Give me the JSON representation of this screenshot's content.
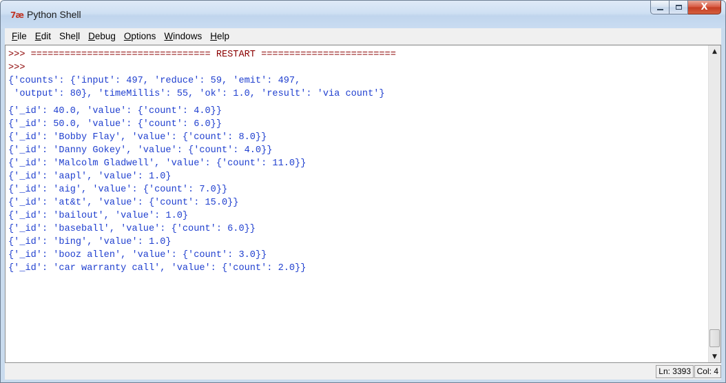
{
  "window": {
    "title": "Python Shell",
    "app_icon_text": "7æ",
    "close_glyph": "X"
  },
  "menu": [
    {
      "pre": "",
      "ul": "F",
      "post": "ile"
    },
    {
      "pre": "",
      "ul": "E",
      "post": "dit"
    },
    {
      "pre": "She",
      "ul": "l",
      "post": "l"
    },
    {
      "pre": "",
      "ul": "D",
      "post": "ebug"
    },
    {
      "pre": "",
      "ul": "O",
      "post": "ptions"
    },
    {
      "pre": "",
      "ul": "W",
      "post": "indows"
    },
    {
      "pre": "",
      "ul": "H",
      "post": "elp"
    }
  ],
  "shell": {
    "lines": [
      {
        "text": ">>> ================================ RESTART ========================",
        "kind": "prompt"
      },
      {
        "text": ">>> ",
        "kind": "prompt"
      },
      {
        "text": "{'counts': {'input': 497, 'reduce': 59, 'emit': 497,",
        "kind": "out"
      },
      {
        "text": " 'output': 80}, 'timeMillis': 55, 'ok': 1.0, 'result': 'via count'}",
        "kind": "out"
      },
      {
        "text": "{'_id': 40.0, 'value': {'count': 4.0}}",
        "kind": "out",
        "gap": true
      },
      {
        "text": "{'_id': 50.0, 'value': {'count': 6.0}}",
        "kind": "out"
      },
      {
        "text": "{'_id': 'Bobby Flay', 'value': {'count': 8.0}}",
        "kind": "out"
      },
      {
        "text": "{'_id': 'Danny Gokey', 'value': {'count': 4.0}}",
        "kind": "out"
      },
      {
        "text": "{'_id': 'Malcolm Gladwell', 'value': {'count': 11.0}}",
        "kind": "out"
      },
      {
        "text": "{'_id': 'aapl', 'value': 1.0}",
        "kind": "out"
      },
      {
        "text": "{'_id': 'aig', 'value': {'count': 7.0}}",
        "kind": "out"
      },
      {
        "text": "{'_id': 'at&t', 'value': {'count': 15.0}}",
        "kind": "out"
      },
      {
        "text": "{'_id': 'bailout', 'value': 1.0}",
        "kind": "out"
      },
      {
        "text": "{'_id': 'baseball', 'value': {'count': 6.0}}",
        "kind": "out"
      },
      {
        "text": "{'_id': 'bing', 'value': 1.0}",
        "kind": "out"
      },
      {
        "text": "{'_id': 'booz allen', 'value': {'count': 3.0}}",
        "kind": "out"
      },
      {
        "text": "{'_id': 'car warranty call', 'value': {'count': 2.0}}",
        "kind": "out"
      }
    ]
  },
  "scrollbar": {
    "up_glyph": "▲",
    "down_glyph": "▼"
  },
  "status": {
    "line": "Ln: 3393",
    "col": "Col: 4"
  }
}
